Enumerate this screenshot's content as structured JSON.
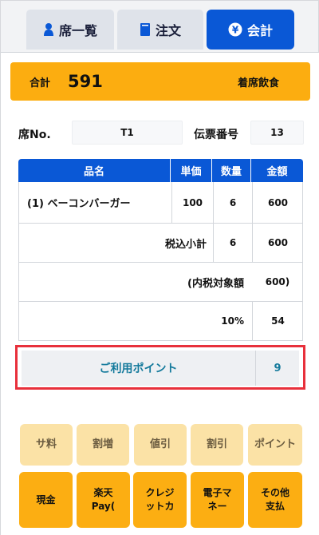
{
  "tabs": [
    {
      "label": "席一覧",
      "icon": "person-icon"
    },
    {
      "label": "注文",
      "icon": "book-icon"
    },
    {
      "label": "会計",
      "icon": "yen-icon",
      "active": true
    }
  ],
  "total": {
    "label": "合計",
    "value": "591",
    "type": "着席飲食"
  },
  "seat": {
    "label": "席No.",
    "value": "T1"
  },
  "slip": {
    "label": "伝票番号",
    "value": "13"
  },
  "table": {
    "headers": [
      "品名",
      "単価",
      "数量",
      "金額"
    ],
    "item": {
      "name": "(1) ベーコンバーガー",
      "price": "100",
      "qty": "6",
      "amount": "600"
    },
    "subtotal": {
      "label": "税込小計",
      "qty": "6",
      "amount": "600"
    },
    "taxable": {
      "label": "(内税対象額",
      "amount": "600)"
    },
    "tax": {
      "rate": "10%",
      "amount": "54"
    }
  },
  "points": {
    "label": "ご利用ポイント",
    "value": "9"
  },
  "adjust_buttons": [
    "サ料",
    "割増",
    "値引",
    "割引",
    "ポイント"
  ],
  "pay_buttons": [
    {
      "line1": "現金",
      "line2": ""
    },
    {
      "line1": "楽天",
      "line2": "Pay("
    },
    {
      "line1": "クレジ",
      "line2": "ットカ"
    },
    {
      "line1": "電子マ",
      "line2": "ネー"
    },
    {
      "line1": "その他",
      "line2": "支払"
    }
  ],
  "colors": {
    "accent": "#0a58d6",
    "orange": "#fcad10",
    "light_orange": "#fbe2a6",
    "highlight": "#e8303b",
    "teal_text": "#147a9c"
  }
}
